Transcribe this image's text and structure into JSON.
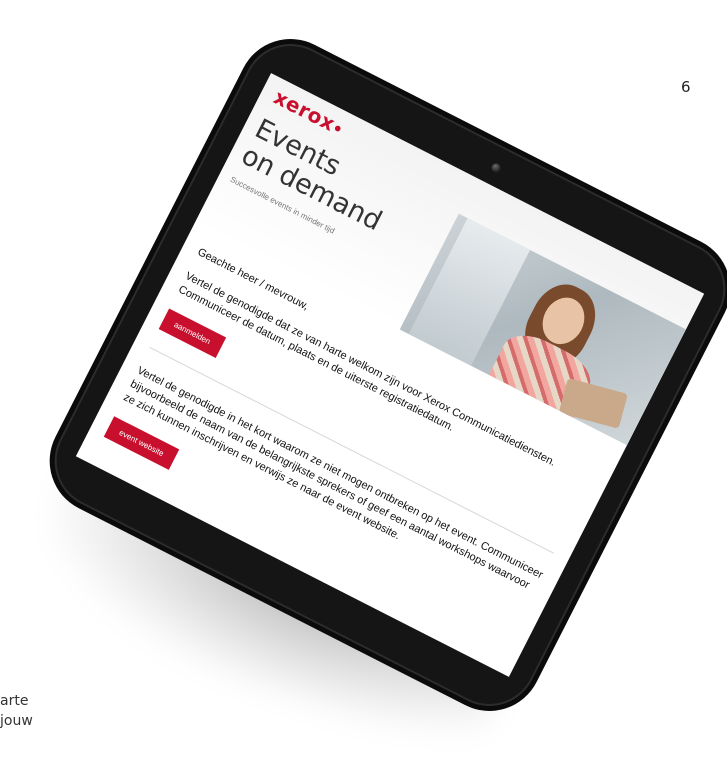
{
  "page": {
    "number": "6"
  },
  "cut_off_text": [
    "arte",
    "jouw"
  ],
  "brand": {
    "logo": "xerox",
    "accent": "#c8102e"
  },
  "email": {
    "title_line1": "Events",
    "title_line2": "on demand",
    "subtitle": "Succesvolle events in minder tijd",
    "salutation": "Geachte heer / mevrouw,",
    "paragraph1": "Vertel de genodigde dat ze van harte welkom zijn voor Xerox Communicatiediensten. Communiceer de datum, plaats en de uiterste registratiedatum.",
    "button1": "aanmelden",
    "paragraph2": "Vertel de genodigde in het kort waarom ze niet mogen ontbreken op het event. Communiceer bijvoorbeeld de naam van de belangrijkste sprekers of geef een aantal workshops waarvoor ze zich kunnen inschrijven en verwijs ze naar de event website.",
    "button2": "event website"
  }
}
